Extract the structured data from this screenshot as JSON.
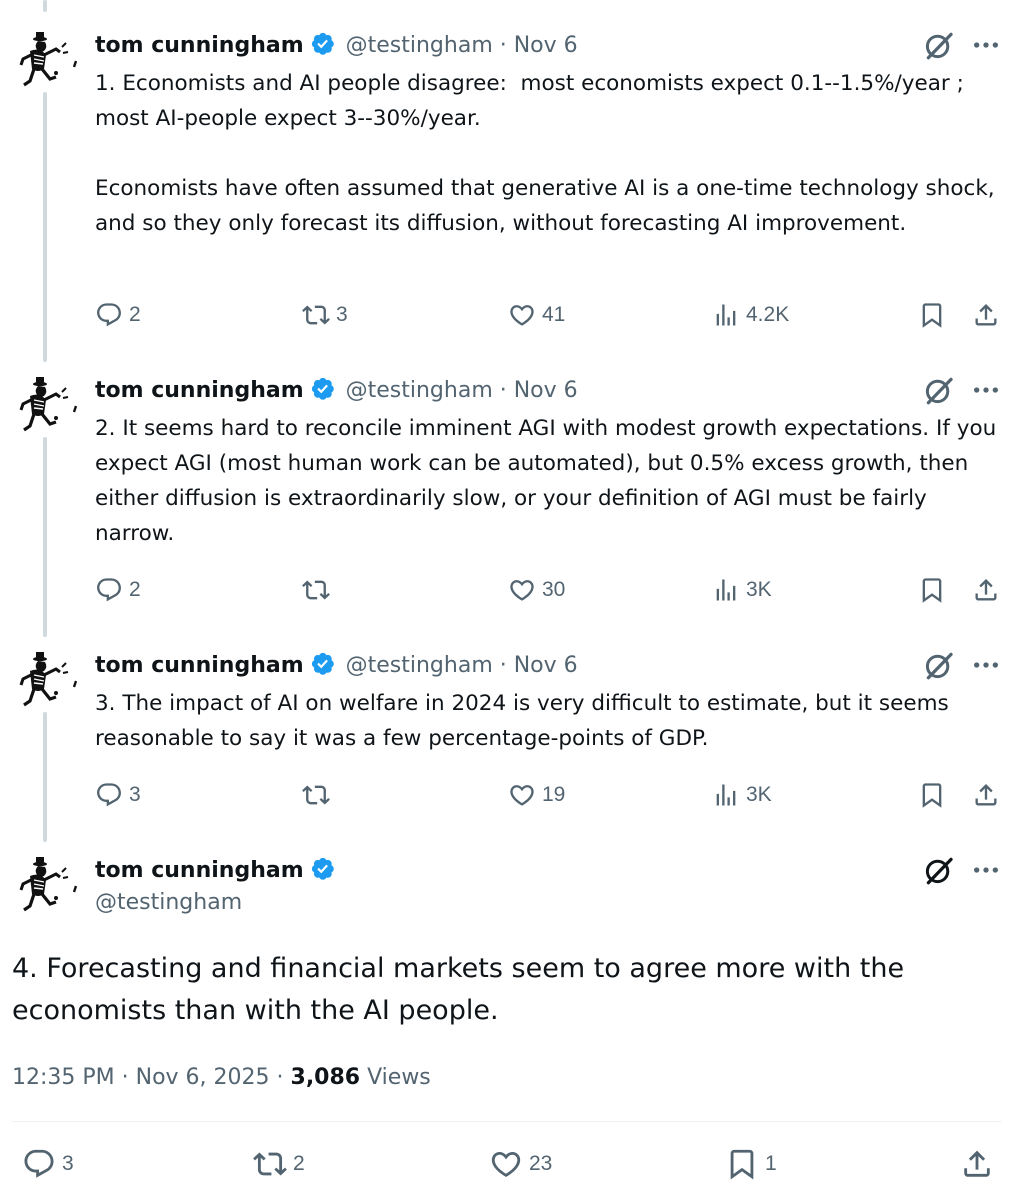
{
  "author": {
    "display_name": "tom cunningham",
    "handle": "@testingham"
  },
  "colors": {
    "verified": "#1d9bf0",
    "secondary_text": "#536471",
    "thread_line": "#cfd9de"
  },
  "thread": [
    {
      "meta": "@testingham · Nov 6",
      "text": "1. Economists and AI people disagree:  most economists expect 0.1--1.5%/year ; most AI-people expect 3--30%/year.\n\nEconomists have often assumed that generative AI is a one-time technology shock, and so they only forecast its diffusion, without forecasting AI improvement.",
      "replies": "2",
      "reposts": "3",
      "likes": "41",
      "views": "4.2K"
    },
    {
      "meta": "@testingham · Nov 6",
      "text": "2. It seems hard to reconcile imminent AGI with modest growth expectations. If you expect AGI (most human work can be automated), but 0.5% excess growth, then either diffusion is extraordinarily slow, or your definition of AGI must be fairly narrow.",
      "replies": "2",
      "reposts": "",
      "likes": "30",
      "views": "3K"
    },
    {
      "meta": "@testingham · Nov 6",
      "text": "3. The impact of AI on welfare in 2024 is very difficult to estimate, but it seems reasonable to say it was a few percentage-points of GDP.",
      "replies": "3",
      "reposts": "",
      "likes": "19",
      "views": "3K"
    }
  ],
  "main_tweet": {
    "text": "4. Forecasting and financial markets seem to agree more with the economists than with the AI people.",
    "time": "12:35 PM · Nov 6, 2025 · ",
    "views_count": "3,086",
    "views_label": " Views",
    "replies": "3",
    "reposts": "2",
    "likes": "23",
    "bookmarks": "1"
  },
  "icons": [
    "reply-icon",
    "repost-icon",
    "like-icon",
    "views-icon",
    "bookmark-icon",
    "share-icon",
    "grok-icon",
    "more-icon",
    "verified-badge-icon"
  ]
}
